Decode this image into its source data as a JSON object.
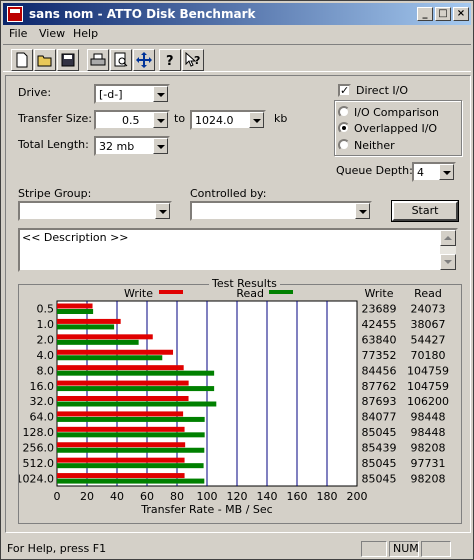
{
  "window": {
    "title": "sans nom - ATTO Disk Benchmark",
    "min_label": "_",
    "max_label": "□",
    "close_label": "×"
  },
  "menu": {
    "file": "File",
    "view": "View",
    "help": "Help"
  },
  "toolbar": [
    "new-icon",
    "open-icon",
    "save-icon",
    "print-icon",
    "print-preview-icon",
    "move-icon",
    "help-icon",
    "context-help-icon"
  ],
  "settings": {
    "drive_label": "Drive:",
    "drive_value": "[-d-]",
    "transfer_label": "Transfer Size:",
    "transfer_from": "0.5",
    "to_label": "to",
    "transfer_to": "1024.0",
    "kb_label": "kb",
    "length_label": "Total Length:",
    "length_value": "32 mb",
    "direct_io_label": "Direct I/O",
    "direct_io_checked": true,
    "io_comparison_label": "I/O Comparison",
    "overlapped_label": "Overlapped I/O",
    "neither_label": "Neither",
    "selected_mode": "Overlapped I/O",
    "queue_label": "Queue Depth:",
    "queue_value": "4",
    "stripe_label": "Stripe Group:",
    "stripe_value": "",
    "controlled_label": "Controlled by:",
    "controlled_value": "",
    "start_label": "Start",
    "description": "<< Description >>"
  },
  "results": {
    "title": "Test Results",
    "write_legend": "Write",
    "read_legend": "Read",
    "write_col": "Write",
    "read_col": "Read",
    "xlabel": "Transfer Rate - MB / Sec",
    "write_color": "#e00000",
    "read_color": "#008000"
  },
  "chart_data": {
    "type": "bar",
    "categories": [
      "0.5",
      "1.0",
      "2.0",
      "4.0",
      "8.0",
      "16.0",
      "32.0",
      "64.0",
      "128.0",
      "256.0",
      "512.0",
      "1024.0"
    ],
    "series": [
      {
        "name": "Write",
        "values": [
          23689,
          42455,
          63840,
          77352,
          84456,
          87762,
          87693,
          84077,
          85045,
          85439,
          85045,
          85045
        ]
      },
      {
        "name": "Read",
        "values": [
          24073,
          38067,
          54427,
          70180,
          104759,
          104759,
          106200,
          98448,
          98448,
          98208,
          97731,
          98208
        ]
      }
    ],
    "xticks": [
      "0",
      "20",
      "40",
      "60",
      "80",
      "100",
      "120",
      "140",
      "160",
      "180",
      "200"
    ],
    "xlim": [
      0,
      200
    ],
    "xlabel": "Transfer Rate - MB / Sec",
    "unit_scale": 1000,
    "grid": true
  },
  "status": {
    "help": "For Help, press F1",
    "num": "NUM"
  }
}
